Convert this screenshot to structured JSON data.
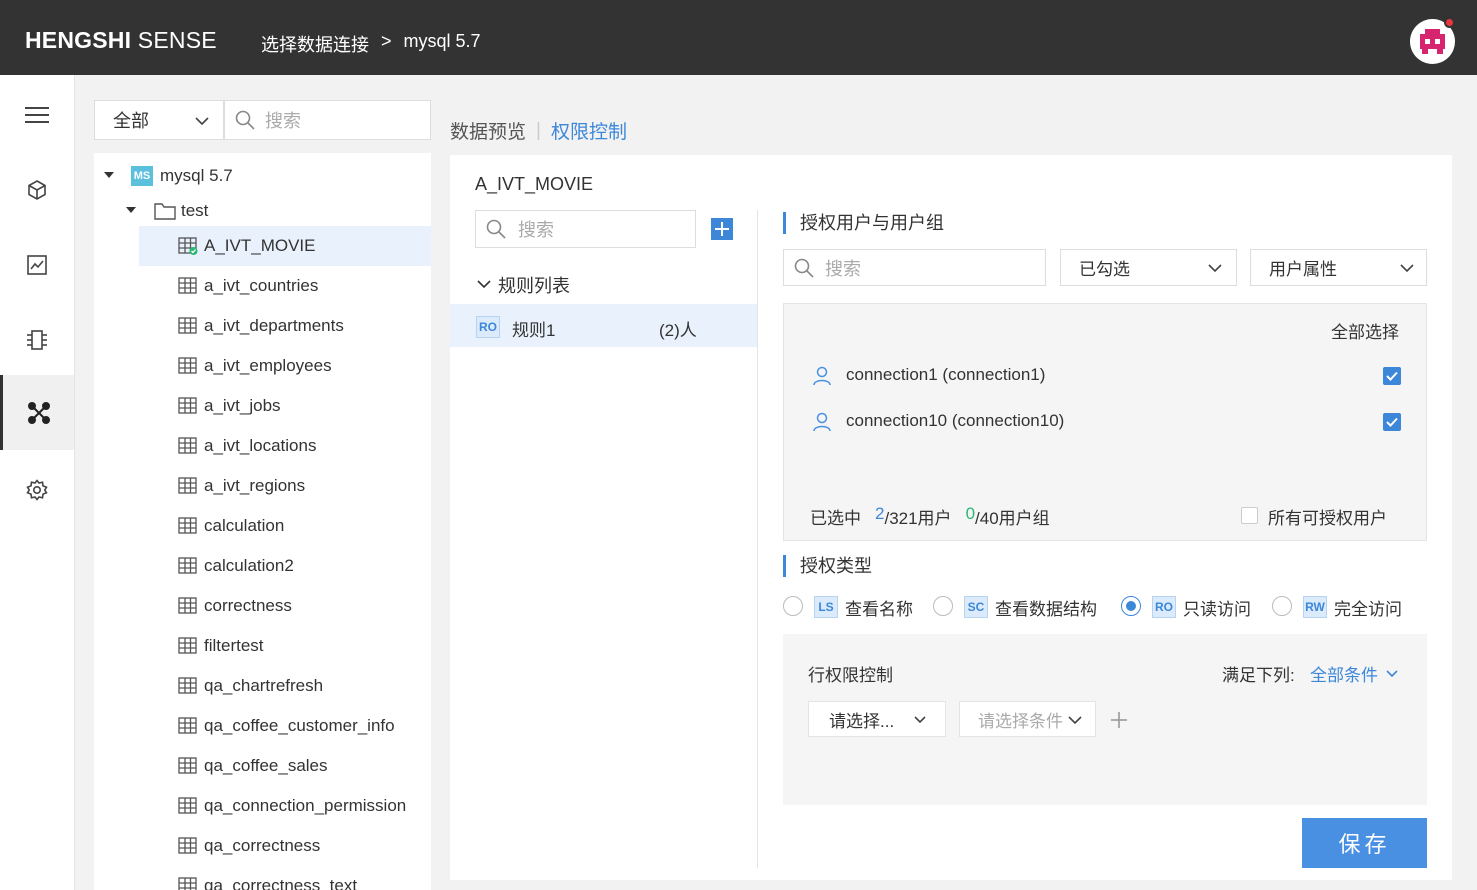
{
  "header": {
    "brand_bold": "HENGSHI",
    "brand_light": "SENSE",
    "breadcrumb": [
      "选择数据连接",
      ">",
      "mysql 5.7"
    ]
  },
  "tree_filter": {
    "select_value": "全部",
    "search_placeholder": "搜索"
  },
  "tree": {
    "connection": {
      "badge": "MS",
      "label": "mysql 5.7"
    },
    "folder": "test",
    "tables": [
      "A_IVT_MOVIE",
      "a_ivt_countries",
      "a_ivt_departments",
      "a_ivt_employees",
      "a_ivt_jobs",
      "a_ivt_locations",
      "a_ivt_regions",
      "calculation",
      "calculation2",
      "correctness",
      "filtertest",
      "qa_chartrefresh",
      "qa_coffee_customer_info",
      "qa_coffee_sales",
      "qa_connection_permission",
      "qa_correctness",
      "qa_correctness_text"
    ]
  },
  "tabs": {
    "preview": "数据预览",
    "separator": "|",
    "permission": "权限控制"
  },
  "rules": {
    "table_title": "A_IVT_MOVIE",
    "search_placeholder": "搜索",
    "list_title": "规则列表",
    "items": [
      {
        "badge": "RO",
        "name": "规则1",
        "count": "(2)人"
      }
    ]
  },
  "grant": {
    "section_title": "授权用户与用户组",
    "search_placeholder": "搜索",
    "filter_value": "已勾选",
    "attribute_value": "用户属性",
    "select_all": "全部选择",
    "users": [
      "connection1 (connection1)",
      "connection10 (connection10)"
    ],
    "summary_prefix": "已选中",
    "selected_users": "2",
    "users_suffix": "/321用户",
    "selected_groups": "0",
    "groups_suffix": "/40用户组",
    "all_users_label": "所有可授权用户"
  },
  "auth_type": {
    "section_title": "授权类型",
    "options": [
      {
        "badge": "LS",
        "label": "查看名称",
        "checked": false
      },
      {
        "badge": "SC",
        "label": "查看数据结构",
        "checked": false
      },
      {
        "badge": "RO",
        "label": "只读访问",
        "checked": true
      },
      {
        "badge": "RW",
        "label": "完全访问",
        "checked": false
      }
    ]
  },
  "row_permission": {
    "title": "行权限控制",
    "match_label": "满足下列:",
    "match_value": "全部条件",
    "field_placeholder": "请选择...",
    "condition_placeholder": "请选择条件"
  },
  "actions": {
    "save": "保存"
  },
  "colors": {
    "accent": "#3d87d9",
    "topbar": "#333333",
    "green": "#2bb673"
  }
}
